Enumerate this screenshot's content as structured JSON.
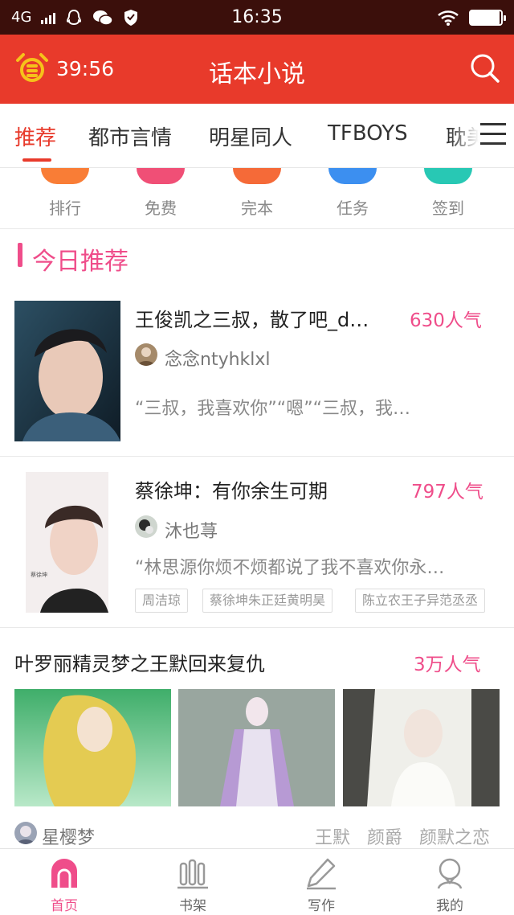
{
  "status_bar": {
    "network": "4G",
    "time": "16:35",
    "battery_level": 0.95,
    "icons": [
      "signal-icon",
      "qq-icon",
      "wechat-icon",
      "shield-icon",
      "wifi-icon",
      "battery-icon"
    ]
  },
  "header": {
    "timer": "39:56",
    "title": "话本小说",
    "accent": "#e83a2b"
  },
  "tabs": {
    "items": [
      "推荐",
      "都市言情",
      "明星同人",
      "TFBOYS",
      "耽美"
    ],
    "active_index": 0
  },
  "quick_entries": [
    {
      "label": "排行",
      "color": "#f97d36"
    },
    {
      "label": "免费",
      "color": "#f04f76"
    },
    {
      "label": "完本",
      "color": "#f56a38"
    },
    {
      "label": "任务",
      "color": "#3c8ff0"
    },
    {
      "label": "签到",
      "color": "#28c8b4"
    }
  ],
  "section": {
    "title": "今日推荐",
    "color": "#ef4d8a"
  },
  "books": [
    {
      "title": "王俊凯之三叔，散了吧_d…",
      "popularity": "630人气",
      "author": "念念ntyhklxl",
      "excerpt": "“三叔，我喜欢你”“嗯”“三叔，我…"
    },
    {
      "title": "蔡徐坤：有你余生可期",
      "popularity": "797人气",
      "author": "沐也荨",
      "excerpt": "“林思源你烦不烦都说了我不喜欢你永…",
      "tags": [
        "周洁琼",
        "蔡徐坤朱正廷黄明昊",
        "陈立农王子异范丞丞"
      ]
    }
  ],
  "featured": {
    "title": "叶罗丽精灵梦之王默回来复仇",
    "popularity": "3万人气",
    "author": "星樱梦",
    "tags": [
      "王默",
      "颜爵",
      "颜默之恋"
    ]
  },
  "bottom_nav": {
    "items": [
      "首页",
      "书架",
      "写作",
      "我的"
    ],
    "active_index": 0,
    "active_color": "#ef4d8a"
  }
}
